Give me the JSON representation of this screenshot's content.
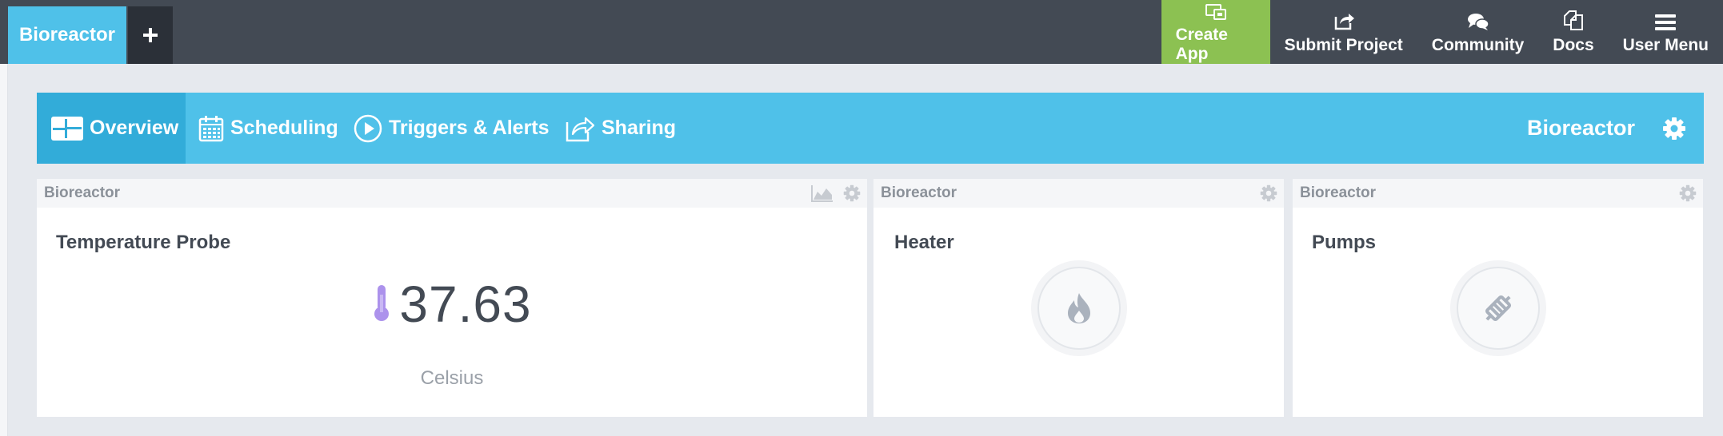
{
  "topbar": {
    "app_tab_label": "Bioreactor",
    "add_tab_symbol": "+",
    "nav": {
      "create_app": "Create App",
      "submit_project": "Submit Project",
      "community": "Community",
      "docs": "Docs",
      "user_menu": "User Menu"
    }
  },
  "dashboard": {
    "tabs": {
      "overview": "Overview",
      "scheduling": "Scheduling",
      "triggers": "Triggers & Alerts",
      "sharing": "Sharing"
    },
    "title": "Bioreactor"
  },
  "cards": {
    "temperature": {
      "device": "Bioreactor",
      "name": "Temperature Probe",
      "value": "37.63",
      "unit": "Celsius"
    },
    "heater": {
      "device": "Bioreactor",
      "name": "Heater"
    },
    "pumps": {
      "device": "Bioreactor",
      "name": "Pumps"
    }
  },
  "icons": {
    "create_app": "create-app-icon",
    "submit_project": "share-icon",
    "community": "chat-bubbles-icon",
    "docs": "docs-icon",
    "user_menu": "hamburger-icon",
    "overview": "dashboard-grid-icon",
    "scheduling": "calendar-icon",
    "triggers": "play-circle-icon",
    "sharing": "share-icon",
    "settings": "gear-icon",
    "chart": "area-chart-icon",
    "thermometer": "thermometer-icon",
    "heater": "flame-icon",
    "pumps": "pump-icon"
  },
  "colors": {
    "topbar": "#434a54",
    "accent_blue": "#4fc1e9",
    "create_green": "#8cc152",
    "thermometer_purple": "#ac92ec"
  }
}
